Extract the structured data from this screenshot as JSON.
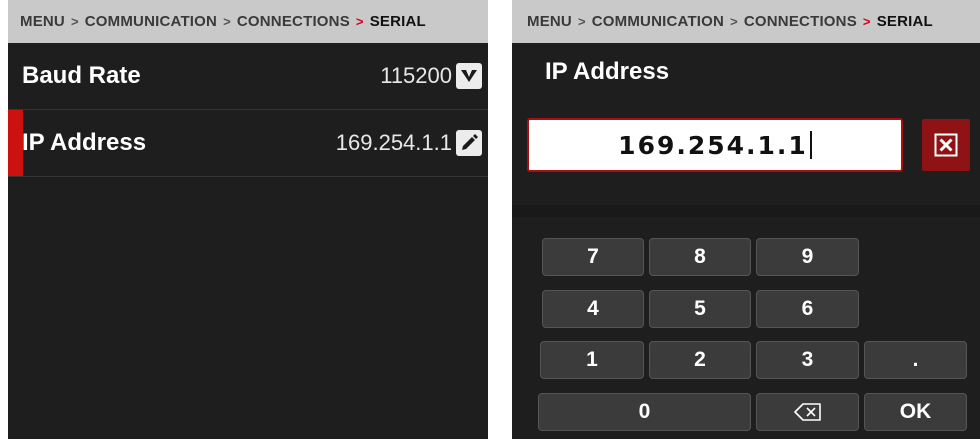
{
  "breadcrumb": {
    "items": [
      "MENU",
      "COMMUNICATION",
      "CONNECTIONS",
      "SERIAL"
    ],
    "separator": ">"
  },
  "settings": {
    "rows": [
      {
        "label": "Baud Rate",
        "value": "115200",
        "action_icon": "chevron-down-icon"
      },
      {
        "label": "IP Address",
        "value": "169.254.1.1",
        "action_icon": "pencil-icon",
        "selected": true
      }
    ]
  },
  "editor": {
    "title": "IP Address",
    "value": "169.254.1.1",
    "clear_icon": "close-box-icon"
  },
  "keypad": {
    "keys": [
      "7",
      "8",
      "9",
      "4",
      "5",
      "6",
      "1",
      "2",
      "3",
      ".",
      "0"
    ],
    "backspace_icon": "backspace-icon",
    "ok_label": "OK"
  },
  "colors": {
    "accent": "#d0021b",
    "selected_bar": "#cc1111",
    "clear_button": "#8f1214",
    "panel_bg": "#1e1e1e",
    "header_bg": "#c9c9c9"
  }
}
